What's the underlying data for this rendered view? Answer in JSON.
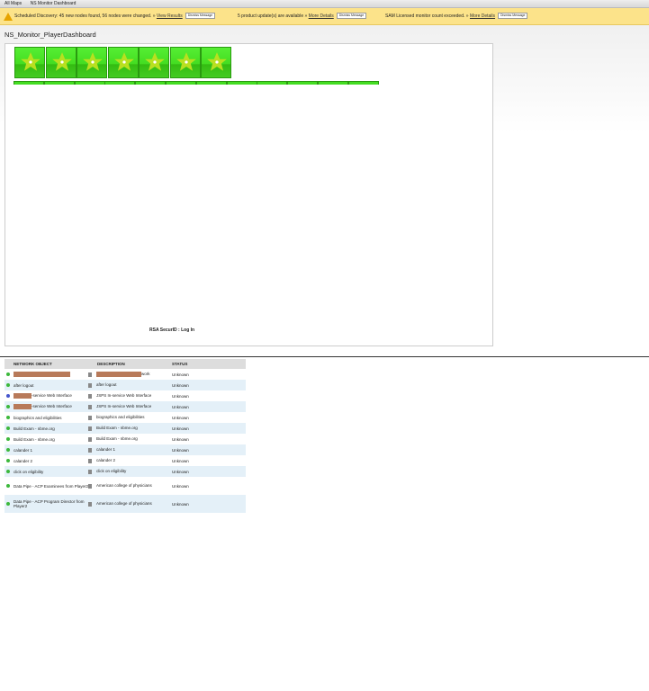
{
  "breadcrumb": [
    "All Maps",
    "NS Monitor Dashboard"
  ],
  "notices": [
    {
      "text": "Scheduled Discovery: 45 new nodes found, 56 nodes were changed. »",
      "link": "View Results",
      "dismiss": "Dismiss Message"
    },
    {
      "text": "5 product update(s) are available »",
      "link": "More Details",
      "dismiss": "Dismiss Message"
    },
    {
      "text": "SAM Licensed monitor count exceeded. »",
      "link": "More Details",
      "dismiss": "Dismiss Message"
    }
  ],
  "page_title": "NS_Monitor_PlayerDashboard",
  "map": {
    "tile_count": 7,
    "row2_count": 12,
    "tile_color": "#44dd22",
    "star_color": "#b8e020",
    "footer": "RSA SecurID : Log In"
  },
  "table": {
    "headers": [
      "NETWORK OBJECT",
      "DESCRIPTION",
      "STATUS"
    ],
    "rows": [
      {
        "object": "",
        "description": "work",
        "status": "Unknown",
        "redact_obj": true,
        "redact_desc": true
      },
      {
        "object": "after logout",
        "description": "after logout",
        "status": "Unknown"
      },
      {
        "object": "-service Web Interface",
        "description": "JSPS In-service Web Interface",
        "status": "Unknown",
        "redact_obj": true,
        "blue": true
      },
      {
        "object": "-service Web Interface",
        "description": "JSPS In-service Web Interface",
        "status": "Unknown",
        "redact_obj": true
      },
      {
        "object": "biographics and eligibilities",
        "description": "biographics and eligibilities",
        "status": "Unknown"
      },
      {
        "object": "Build Exam - nbme.org",
        "description": "Build Exam - nbme.org",
        "status": "Unknown"
      },
      {
        "object": "Build Exam - nbme.org",
        "description": "Build Exam - nbme.org",
        "status": "Unknown"
      },
      {
        "object": "calander 1",
        "description": "calander 1",
        "status": "Unknown"
      },
      {
        "object": "calander 2",
        "description": "calander 2",
        "status": "Unknown"
      },
      {
        "object": "click on eligibility",
        "description": "click on eligibility",
        "status": "Unknown"
      },
      {
        "object": "Data Pipe - ACP Examinees from Player2",
        "description": "American college of physicians",
        "status": "Unknown",
        "tall": true
      },
      {
        "object": "Data Pipe - ACP Program Director from Player2",
        "description": "American college of physicians",
        "status": "Unknown",
        "tall": true
      }
    ]
  }
}
